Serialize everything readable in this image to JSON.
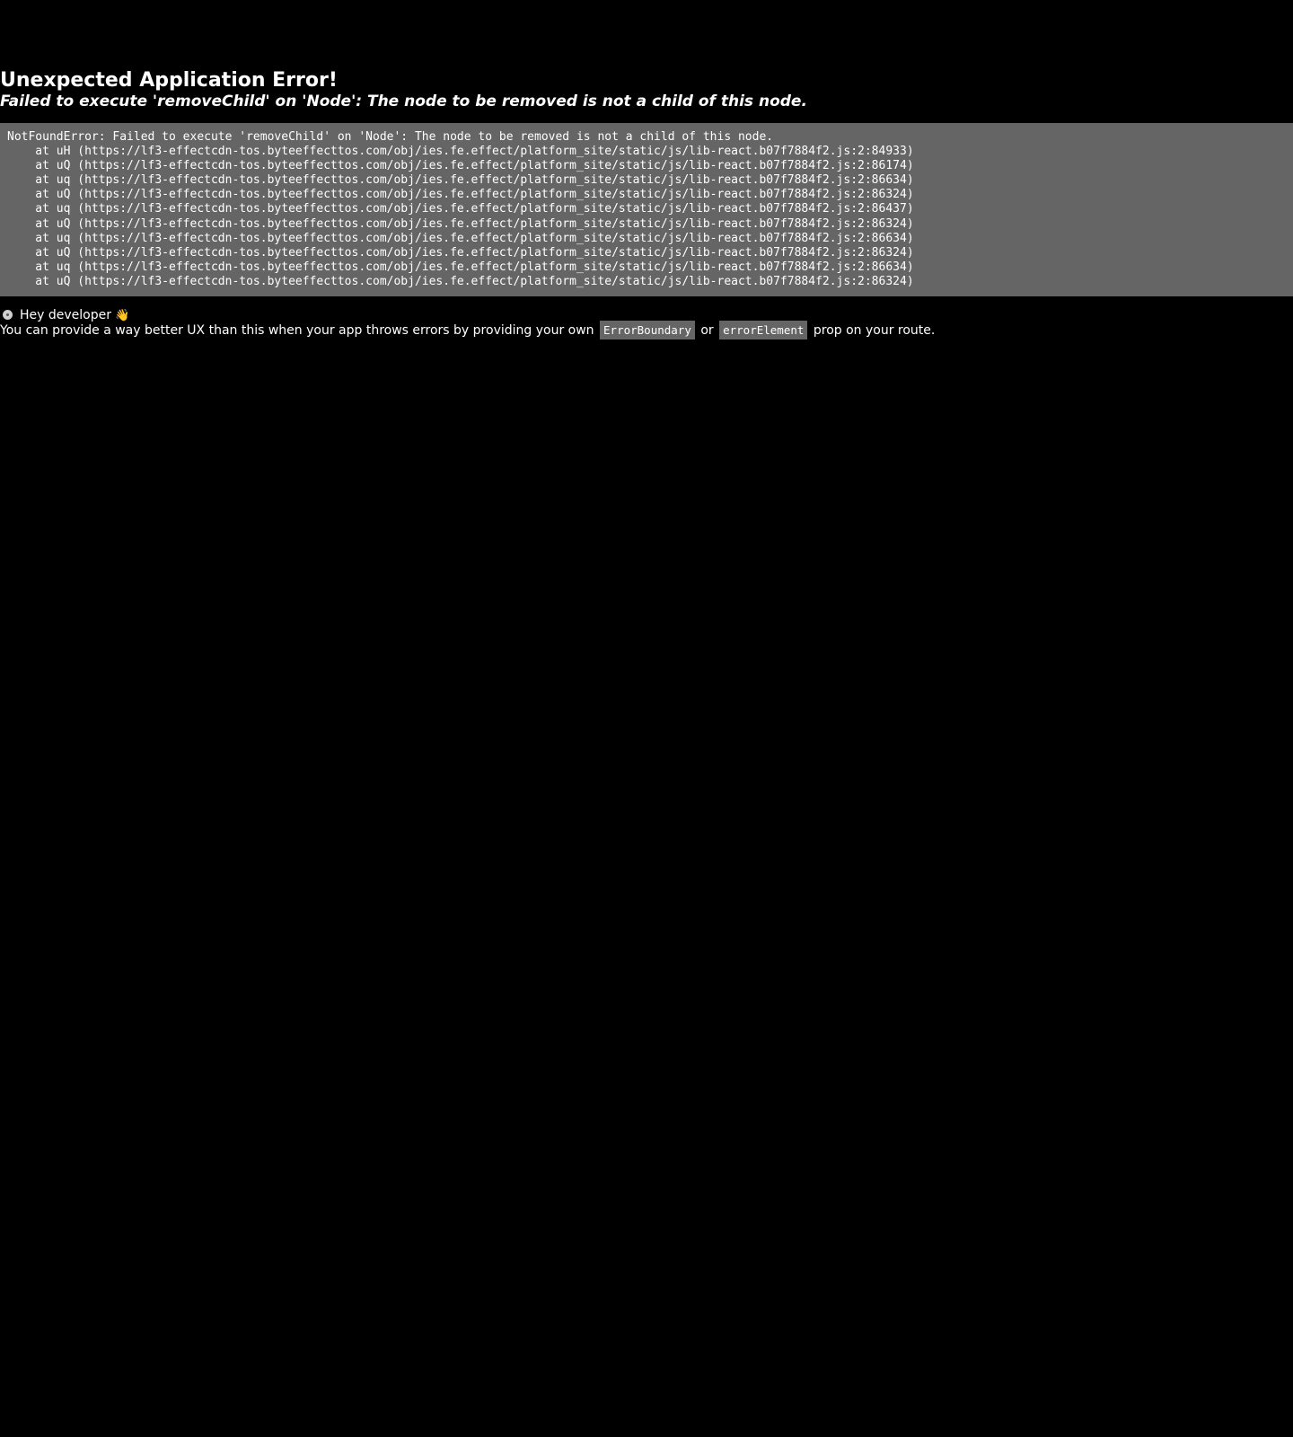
{
  "error": {
    "title": "Unexpected Application Error!",
    "message": "Failed to execute 'removeChild' on 'Node': The node to be removed is not a child of this node.",
    "stack_lines": [
      "NotFoundError: Failed to execute 'removeChild' on 'Node': The node to be removed is not a child of this node.",
      "    at uH (https://lf3-effectcdn-tos.byteeffecttos.com/obj/ies.fe.effect/platform_site/static/js/lib-react.b07f7884f2.js:2:84933)",
      "    at uQ (https://lf3-effectcdn-tos.byteeffecttos.com/obj/ies.fe.effect/platform_site/static/js/lib-react.b07f7884f2.js:2:86174)",
      "    at uq (https://lf3-effectcdn-tos.byteeffecttos.com/obj/ies.fe.effect/platform_site/static/js/lib-react.b07f7884f2.js:2:86634)",
      "    at uQ (https://lf3-effectcdn-tos.byteeffecttos.com/obj/ies.fe.effect/platform_site/static/js/lib-react.b07f7884f2.js:2:86324)",
      "    at uq (https://lf3-effectcdn-tos.byteeffecttos.com/obj/ies.fe.effect/platform_site/static/js/lib-react.b07f7884f2.js:2:86437)",
      "    at uQ (https://lf3-effectcdn-tos.byteeffecttos.com/obj/ies.fe.effect/platform_site/static/js/lib-react.b07f7884f2.js:2:86324)",
      "    at uq (https://lf3-effectcdn-tos.byteeffecttos.com/obj/ies.fe.effect/platform_site/static/js/lib-react.b07f7884f2.js:2:86634)",
      "    at uQ (https://lf3-effectcdn-tos.byteeffecttos.com/obj/ies.fe.effect/platform_site/static/js/lib-react.b07f7884f2.js:2:86324)",
      "    at uq (https://lf3-effectcdn-tos.byteeffecttos.com/obj/ies.fe.effect/platform_site/static/js/lib-react.b07f7884f2.js:2:86634)",
      "    at uQ (https://lf3-effectcdn-tos.byteeffecttos.com/obj/ies.fe.effect/platform_site/static/js/lib-react.b07f7884f2.js:2:86324)"
    ]
  },
  "hint": {
    "disc_icon": "disc-icon",
    "greeting": "Hey developer",
    "wave_icon": "waving-hand-icon",
    "wave_glyph": "👋",
    "text_before": "You can provide a way better UX than this when your app throws errors by providing your own",
    "code_1": "ErrorBoundary",
    "text_middle": "or",
    "code_2": "errorElement",
    "text_after": "prop on your route."
  },
  "colors": {
    "background": "#000000",
    "text": "#ffffff",
    "code_background": "#656565"
  }
}
